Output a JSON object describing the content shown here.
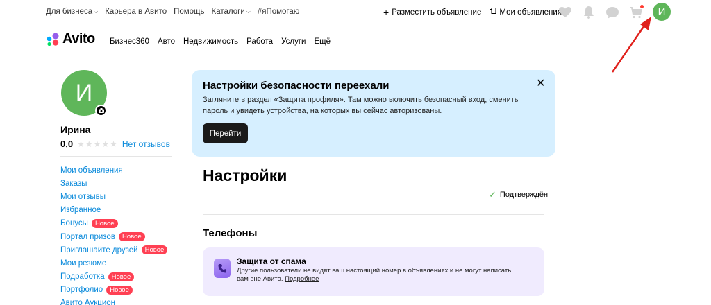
{
  "topnav": {
    "items": [
      {
        "label": "Для бизнеса",
        "has_chevron": true
      },
      {
        "label": "Карьера в Авито",
        "has_chevron": false
      },
      {
        "label": "Помощь",
        "has_chevron": false
      },
      {
        "label": "Каталоги",
        "has_chevron": true
      },
      {
        "label": "#яПомогаю",
        "has_chevron": false
      }
    ],
    "post_ad": "Разместить объявление",
    "my_ads": "Мои объявления",
    "avatar_letter": "И"
  },
  "logo": {
    "text": "Avito"
  },
  "mainnav": {
    "items": [
      "Бизнес360",
      "Авто",
      "Недвижимость",
      "Работа",
      "Услуги",
      "Ещё"
    ]
  },
  "profile": {
    "avatar_letter": "И",
    "name": "Ирина",
    "rating": "0,0",
    "stars": "★★★★★",
    "no_reviews": "Нет отзывов"
  },
  "sidebar": {
    "badge_label": "Новое",
    "items": [
      {
        "label": "Мои объявления",
        "badge": false
      },
      {
        "label": "Заказы",
        "badge": false
      },
      {
        "label": "Мои отзывы",
        "badge": false
      },
      {
        "label": "Избранное",
        "badge": false
      },
      {
        "label": "Бонусы",
        "badge": true
      },
      {
        "label": "Портал призов",
        "badge": true
      },
      {
        "label": "Приглашайте друзей",
        "badge": true
      },
      {
        "label": "Мои резюме",
        "badge": false
      },
      {
        "label": "Подработка",
        "badge": true
      },
      {
        "label": "Портфолио",
        "badge": true
      },
      {
        "label": "Авито Аукцион",
        "badge": false
      }
    ]
  },
  "banner": {
    "title": "Настройки безопасности переехали",
    "text": "Загляните в раздел «Защита профиля». Там можно включить безопасный вход, сменить пароль и увидеть устройства, на которых вы сейчас авторизованы.",
    "button": "Перейти",
    "close": "✕"
  },
  "settings": {
    "title": "Настройки",
    "verified": "Подтверждён",
    "phones_title": "Телефоны"
  },
  "spam": {
    "title": "Защита от спама",
    "text": "Другие пользователи не видят ваш настоящий номер в объявлениях и не могут написать вам вне Авито.",
    "link": "Подробнее"
  },
  "colors": {
    "brand_green": "#5fb65a",
    "link_blue": "#0a8adb",
    "badge_red": "#ff4053",
    "banner_bg": "#d6efff",
    "spam_bg": "#f0ebfe",
    "arrow_red": "#e0201b"
  },
  "icons": [
    "plus-icon",
    "copy-icon",
    "heart-icon",
    "bell-icon",
    "chat-icon",
    "cart-icon",
    "camera-icon",
    "check-icon",
    "phone-shield-icon",
    "close-icon"
  ]
}
